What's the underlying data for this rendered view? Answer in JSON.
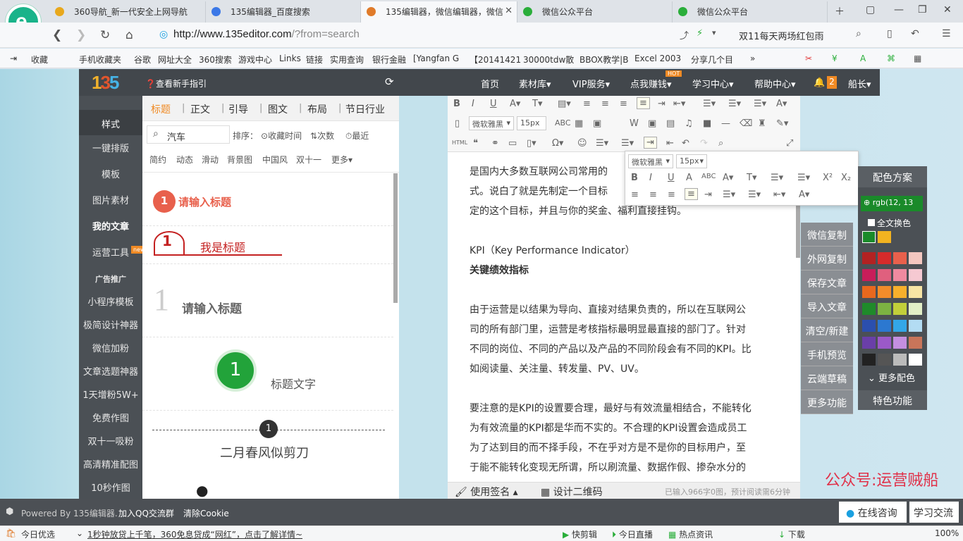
{
  "browser": {
    "tabs": [
      {
        "label": "360导航_新一代安全上网导航",
        "color": "#e8a81c"
      },
      {
        "label": "135编辑器_百度搜索",
        "color": "#3b78e7"
      },
      {
        "label": "135编辑器，微信编辑器，微信",
        "color": "#e07b2a"
      },
      {
        "label": "微信公众平台",
        "color": "#2aae3a"
      },
      {
        "label": "微信公众平台",
        "color": "#2aae3a"
      }
    ],
    "url_host": "http://www.135editor.com",
    "url_path": "/?from=search",
    "right_search": "双11每天两场红包雨",
    "bookmarks": [
      "收藏",
      "手机收藏夹",
      "谷歌",
      "网址大全",
      "360搜索",
      "游戏中心",
      "Links",
      "链接",
      "实用查询",
      "银行金融",
      "[Yangfan G",
      "【20141421",
      "30000tdw散",
      "BBOX教学|B",
      "Excel 2003",
      "分享几个目"
    ]
  },
  "sidebar": {
    "help": "查看新手指引",
    "items": [
      "样式",
      "一键排版",
      "模板",
      "图片素材",
      "我的文章",
      "运营工具",
      "广告推广",
      "小程序模板",
      "极简设计神器",
      "微信加粉",
      "文章选题神器",
      "1天增粉5W+",
      "免费作图",
      "双十一吸粉",
      "高清精准配图",
      "10秒作图"
    ],
    "new_badge": "new"
  },
  "panel": {
    "tabs": [
      "标题",
      "正文",
      "引导",
      "图文",
      "布局",
      "节日行业"
    ],
    "search_value": "汽车",
    "sort_label": "排序：",
    "sort_options": [
      "收藏时间",
      "次数",
      "最近"
    ],
    "filters": [
      "简约",
      "动态",
      "滑动",
      "背景图",
      "中国风",
      "双十一",
      "更多▾"
    ],
    "samples": [
      {
        "num": "1",
        "text": "请输入标题"
      },
      {
        "num": "1",
        "text": "我是标题"
      },
      {
        "num": "1",
        "text": "请输入标题"
      },
      {
        "num": "1",
        "text": "标题文字"
      },
      {
        "num": "1",
        "text": "二月春风似剪刀"
      }
    ]
  },
  "topnav": {
    "items": [
      "首页",
      "素材库▾",
      "VIP服务▾",
      "点我赚钱▾",
      "学习中心▾",
      "帮助中心▾"
    ],
    "hot": "HOT",
    "notif_count": "2",
    "user": "船长▾"
  },
  "toolbar": {
    "font": "微软雅黑",
    "size": "15px"
  },
  "floatbar": {
    "font": "微软雅黑",
    "size": "15px"
  },
  "doc": {
    "paragraphs": [
      "是国内大多数互联网公司常用的",
      "式。说白了就是先制定一个目标",
      "定的这个目标，并且与你的奖金、福利直接挂钩。",
      "",
      "KPI（Key Performance Indicator）",
      "关键绩效指标",
      "",
      "由于运营是以结果为导向、直接对结果负责的，所以在互联网公",
      "司的所有部门里，运营是考核指标最明显最直接的部门了。针对",
      "不同的岗位、不同的产品以及产品的不同阶段会有不同的KPI。比",
      "如阅读量、关注量、转发量、PV、UV。",
      "",
      "要注意的是KPI的设置要合理，最好与有效流量相结合，不能转化",
      "为有效流量的KPI都是华而不实的。不合理的KPI设置会造成员工",
      "为了达到目的而不择手段，不在乎对方是不是你的目标用户，至",
      "于能不能转化变现无所谓，所以刷流量、数据作假、掺杂水分的"
    ],
    "footer_sign": "使用签名",
    "footer_qr": "设计二维码",
    "footer_count": "已输入966字0图，预计阅读需6分钟"
  },
  "right_buttons": [
    "微信复制",
    "外网复制",
    "保存文章",
    "导入文章",
    "清空/新建",
    "手机预览",
    "云端草稿",
    "更多功能"
  ],
  "color_panel": {
    "title": "配色方案",
    "rgb": "rgb(12, 13",
    "all_text": "全文换色",
    "more": "更多配色",
    "special": "特色功能",
    "swatches": [
      "#1a8a2a",
      "#f2b320",
      "#b22222",
      "#d62b2b",
      "#e8604c",
      "#f4c7c0",
      "#c81d5a",
      "#e0607e",
      "#f08aa0",
      "#f6c9d2",
      "#e8681e",
      "#f28c2a",
      "#f7b02c",
      "#f7e4a4",
      "#1f8a2a",
      "#7cb342",
      "#c2cf3a",
      "#e2efc6",
      "#2b4fae",
      "#2c78d0",
      "#33a7e8",
      "#b3dcf3",
      "#6a3fa8",
      "#9b59c8",
      "#c48fe0",
      "#c8755a",
      "#222222",
      "#555555",
      "#bbbbbb",
      "#ffffff"
    ]
  },
  "watermark": "公众号:运营贼船",
  "bottom": {
    "powered": "Powered By 135编辑器.",
    "qq": "加入QQ交流群",
    "cookie": "清除Cookie",
    "online": "在线咨询",
    "learn": "学习交流"
  },
  "status": {
    "today": "今日优选",
    "ad": "1秒钟放贷上千笔，360免息贷成“网红”，点击了解详情~",
    "items": [
      "快剪辑",
      "今日直播",
      "热点资讯",
      "下载"
    ],
    "zoom": "100%"
  }
}
